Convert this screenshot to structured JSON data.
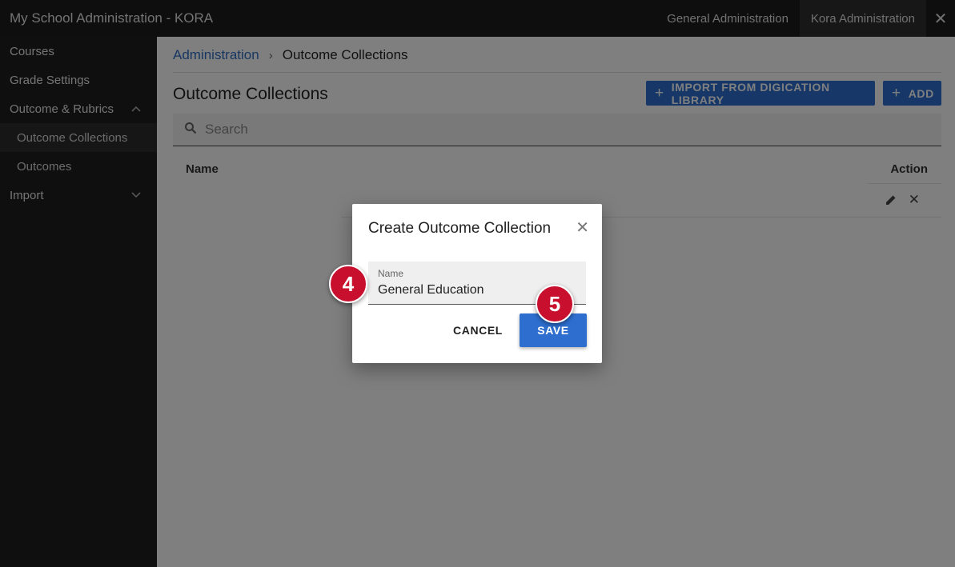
{
  "topbar": {
    "title": "My School Administration - KORA",
    "tabs": [
      {
        "label": "General Administration"
      },
      {
        "label": "Kora Administration"
      }
    ],
    "close_icon": "close-icon"
  },
  "sidebar": {
    "items": [
      {
        "label": "Courses"
      },
      {
        "label": "Grade Settings"
      },
      {
        "label": "Outcome & Rubrics"
      },
      {
        "label": "Outcome Collections"
      },
      {
        "label": "Outcomes"
      },
      {
        "label": "Import"
      }
    ]
  },
  "breadcrumb": {
    "root": "Administration",
    "separator": "›",
    "current": "Outcome Collections"
  },
  "page": {
    "title": "Outcome Collections",
    "import_label": "IMPORT FROM DIGICATION LIBRARY",
    "add_label": "ADD"
  },
  "search": {
    "placeholder": "Search"
  },
  "table": {
    "headers": {
      "name": "Name",
      "action": "Action"
    }
  },
  "dialog": {
    "title": "Create Outcome Collection",
    "field_label": "Name",
    "field_value": "General Education",
    "cancel_label": "CANCEL",
    "save_label": "SAVE"
  },
  "badges": [
    {
      "label": "4"
    },
    {
      "label": "5"
    }
  ],
  "colors": {
    "accent": "#2d6ecf",
    "topbar": "#1c1c1c",
    "sidebar": "#1f1f1f",
    "badge": "#c8102e"
  }
}
